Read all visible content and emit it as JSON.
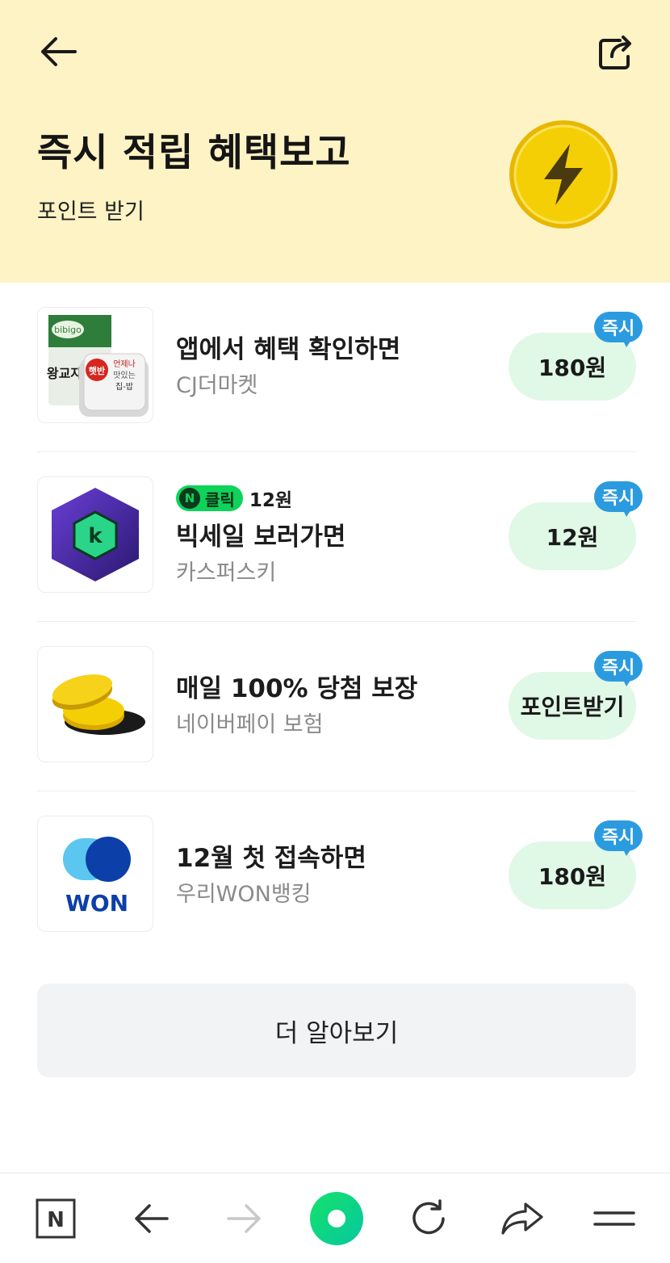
{
  "header": {
    "title": "즉시 적립 혜택보고",
    "subtitle": "포인트 받기"
  },
  "instant_badge": "즉시",
  "items": [
    {
      "title": "앱에서 혜택 확인하면",
      "sub": "CJ더마켓",
      "reward": "180원",
      "thumb_texts": [
        "bibigo",
        "왕교자",
        "햇반",
        "언제나",
        "맛있는",
        "집-밥"
      ]
    },
    {
      "click_label": "클릭",
      "click_amount": "12원",
      "title": "빅세일 보러가면",
      "sub": "카스퍼스키",
      "reward": "12원",
      "thumb_letter": "k"
    },
    {
      "title": "매일 100% 당첨 보장",
      "sub": "네이버페이 보험",
      "reward": "포인트받기"
    },
    {
      "title": "12월 첫 접속하면",
      "sub": "우리WON뱅킹",
      "reward": "180원",
      "thumb_text": "WON"
    }
  ],
  "more_button": "더 알아보기",
  "bottom_nav": {
    "home_letter": "N"
  },
  "icons": [
    "back-arrow-icon",
    "share-icon",
    "lightning-coin-icon",
    "naver-home-icon",
    "nav-back-icon",
    "nav-forward-icon",
    "green-dot-icon",
    "refresh-icon",
    "share-arrow-icon",
    "menu-icon"
  ],
  "colors": {
    "header_bg": "#fdf3c4",
    "reward_bg": "#e0f8e6",
    "badge_blue": "#2b9be0",
    "naver_green": "#0ed35a",
    "coin_yellow": "#f5cf06"
  }
}
